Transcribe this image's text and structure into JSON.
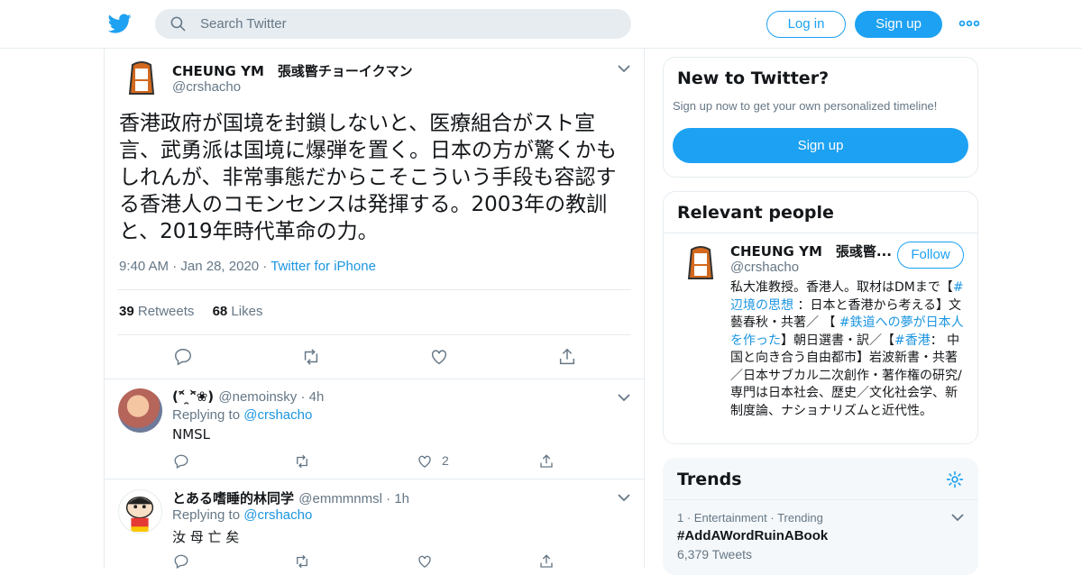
{
  "header": {
    "search_placeholder": "Search Twitter",
    "login_label": "Log in",
    "signup_label": "Sign up",
    "accent": "#1da1f2"
  },
  "tweet": {
    "name": "CHEUNG YM　張彧暋チョーイクマン",
    "handle": "@crshacho",
    "text": "香港政府が国境を封鎖しないと、医療組合がスト宣言、武勇派は国境に爆弾を置く。日本の方が驚くかもしれんが、非常事態だからこそこういう手段も容認する香港人のコモンセンスは発揮する。2003年の教訓と、2019年時代革命の力。",
    "time": "9:40 AM",
    "date": "Jan 28, 2020",
    "source": "Twitter for iPhone",
    "retweets": "39",
    "retweets_label": "Retweets",
    "likes": "68",
    "likes_label": "Likes"
  },
  "replies": [
    {
      "name": "(ᵔ᷄ ̯ᵔ᷅❀)",
      "handle": "@nemoinsky",
      "age": "4h",
      "replying_label": "Replying to",
      "replying_to": "@crshacho",
      "text": "NMSL",
      "like_count": "2"
    },
    {
      "name": "とある嗜睡的林同学",
      "handle": "@emmmnmsl",
      "age": "1h",
      "replying_label": "Replying to",
      "replying_to": "@crshacho",
      "text": "汝 母 亡 矣",
      "like_count": ""
    }
  ],
  "sidebar": {
    "new_title": "New to Twitter?",
    "new_sub": "Sign up now to get your own personalized timeline!",
    "new_button": "Sign up",
    "relevant_title": "Relevant people",
    "person_name": "CHEUNG YM　張彧暋...",
    "person_handle": "@crshacho",
    "follow_label": "Follow",
    "bio_parts": [
      "私大准教授。香港人。取材はDMまで【",
      "#辺境の思想",
      " ：日本と香港から考える】文藝春秋・共著／ 【 ",
      "#鉄道への夢が日本人を作った",
      "】朝日選書・訳／【",
      "#香港",
      "： 中国と向き合う自由都市】岩波新書・共著／日本サブカル二次創作・著作権の研究/ 専門は日本社会、歴史／文化社会学、新制度論、ナショナリズムと近代性。"
    ],
    "trends_title": "Trends",
    "trend": {
      "rank": "1",
      "category": "Entertainment",
      "status": "Trending",
      "name": "#AddAWordRuinABook",
      "count": "6,379 Tweets"
    }
  }
}
